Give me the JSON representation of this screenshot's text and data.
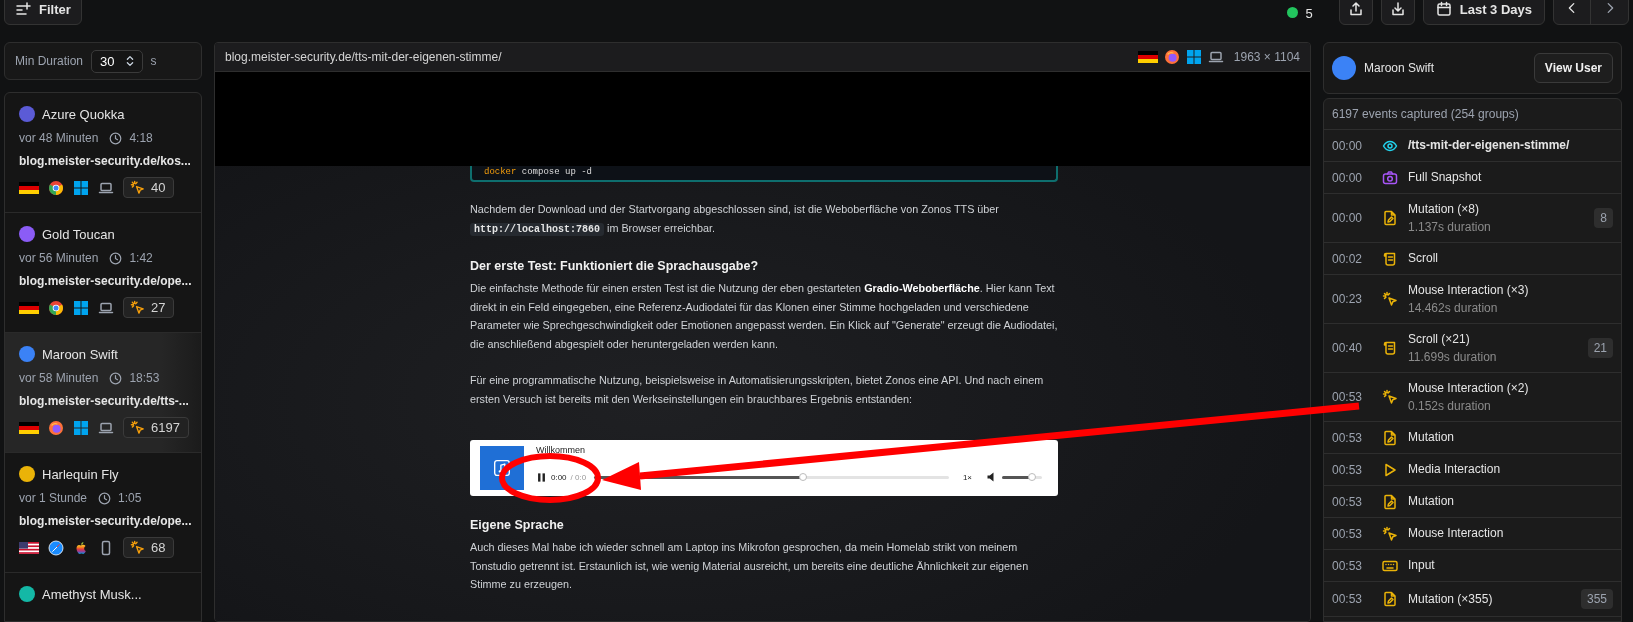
{
  "toolbar": {
    "filter_label": "Filter",
    "live_count": "5",
    "date_range": "Last 3 Days"
  },
  "min_duration": {
    "label": "Min Duration",
    "value": "30",
    "unit": "s"
  },
  "sessions": [
    {
      "name": "Azure Quokka",
      "color": "#5b5bd6",
      "ago": "vor 48 Minuten",
      "duration": "4:18",
      "url": "blog.meister-security.de/kos...",
      "icons": [
        {
          "kind": "de"
        },
        {
          "kind": "chrome"
        },
        {
          "kind": "windows"
        },
        {
          "kind": "laptop"
        }
      ],
      "events": "40",
      "selected": false
    },
    {
      "name": "Gold Toucan",
      "color": "#8b5cf6",
      "ago": "vor 56 Minuten",
      "duration": "1:42",
      "url": "blog.meister-security.de/ope...",
      "icons": [
        {
          "kind": "de"
        },
        {
          "kind": "chrome"
        },
        {
          "kind": "windows"
        },
        {
          "kind": "laptop"
        }
      ],
      "events": "27",
      "selected": false
    },
    {
      "name": "Maroon Swift",
      "color": "#3b82f6",
      "ago": "vor 58 Minuten",
      "duration": "18:53",
      "url": "blog.meister-security.de/tts-...",
      "icons": [
        {
          "kind": "de"
        },
        {
          "kind": "firefox"
        },
        {
          "kind": "windows"
        },
        {
          "kind": "laptop"
        }
      ],
      "events": "6197",
      "selected": true
    },
    {
      "name": "Harlequin Fly",
      "color": "#eab308",
      "ago": "vor 1 Stunde",
      "duration": "1:05",
      "url": "blog.meister-security.de/ope...",
      "icons": [
        {
          "kind": "us"
        },
        {
          "kind": "safari"
        },
        {
          "kind": "apple"
        },
        {
          "kind": "phone"
        }
      ],
      "events": "68",
      "selected": false
    },
    {
      "name": "Amethyst Musk...",
      "color": "#14b8a6",
      "selected": false
    }
  ],
  "recording": {
    "url": "blog.meister-security.de/tts-mit-der-eigenen-stimme/",
    "icons": [
      {
        "kind": "de"
      },
      {
        "kind": "firefox"
      },
      {
        "kind": "windows"
      },
      {
        "kind": "laptop"
      }
    ],
    "resolution": "1963 × 1104"
  },
  "article": {
    "code": {
      "command": "docker",
      "args": "compose up -d"
    },
    "blocks": [
      {
        "kind": "code_text",
        "before": "Nachdem der Download und der Startvorgang abgeschlossen sind, ist die Weboberfläche von Zonos TTS über",
        "code": "http://localhost:7860",
        "after": "im Browser erreichbar."
      },
      {
        "kind": "heading",
        "text": "Der erste Test: Funktioniert die Sprachausgabe?"
      },
      {
        "kind": "text",
        "text": "Die einfachste Methode für einen ersten Test ist die Nutzung der eben gestarteten **Gradio-Weboberfläche**. Hier kann Text direkt in ein Feld eingegeben, eine Referenz-Audiodatei für das Klonen einer Stimme hochgeladen und verschiedene Parameter wie Sprechgeschwindigkeit oder Emotionen angepasst werden. Ein Klick auf \"Generate\" erzeugt die Audiodatei, die anschließend abgespielt oder heruntergeladen werden kann."
      },
      {
        "kind": "text",
        "text": "Für eine programmatische Nutzung, beispielsweise in Automatisierungsskripten, bietet Zonos eine API. Und nach einem ersten Versuch ist bereits mit den Werkseinstellungen ein brauchbares Ergebnis entstanden:"
      },
      {
        "kind": "player",
        "title": "Willkommen",
        "playing": true,
        "time": "0:00",
        "total": "/ 0:0",
        "progress": {
          "level": 0.59
        },
        "speed": "1×",
        "volume": {
          "level": 0.75
        }
      },
      {
        "kind": "heading",
        "text": "Eigene Sprache"
      },
      {
        "kind": "text",
        "text": "Auch dieses Mal habe ich wieder schnell am Laptop ins Mikrofon gesprochen, da mein Homelab strikt von meinem Tonstudio getrennt ist. Erstaunlich ist, wie wenig Material ausreicht, um bereits eine deutliche Ähnlichkeit zur eigenen Stimme zu erzeugen."
      }
    ]
  },
  "user": {
    "name": "Maroon Swift",
    "color": "#3b82f6",
    "button": "View User"
  },
  "events": {
    "summary": "6197 events captured (254 groups)",
    "items": [
      {
        "time": "00:00",
        "kind": "pageview",
        "title": "/tts-mit-der-eigenen-stimme/"
      },
      {
        "time": "00:00",
        "kind": "snapshot",
        "title": "Full Snapshot"
      },
      {
        "time": "00:00",
        "kind": "mutation",
        "title": "Mutation (×8)",
        "duration": "1.137s duration",
        "count": "8"
      },
      {
        "time": "00:02",
        "kind": "scroll",
        "title": "Scroll"
      },
      {
        "time": "00:23",
        "kind": "mouse",
        "title": "Mouse Interaction (×3)",
        "duration": "14.462s duration"
      },
      {
        "time": "00:40",
        "kind": "scroll",
        "title": "Scroll (×21)",
        "duration": "11.699s duration",
        "count": "21"
      },
      {
        "time": "00:53",
        "kind": "mouse",
        "title": "Mouse Interaction (×2)",
        "duration": "0.152s duration"
      },
      {
        "time": "00:53",
        "kind": "mutation",
        "title": "Mutation"
      },
      {
        "time": "00:53",
        "kind": "media",
        "title": "Media Interaction"
      },
      {
        "time": "00:53",
        "kind": "mutation",
        "title": "Mutation"
      },
      {
        "time": "00:53",
        "kind": "mouse",
        "title": "Mouse Interaction"
      },
      {
        "time": "00:53",
        "kind": "input",
        "title": "Input"
      },
      {
        "time": "00:53",
        "kind": "mutation",
        "title": "Mutation (×355)",
        "count": "355"
      }
    ]
  }
}
